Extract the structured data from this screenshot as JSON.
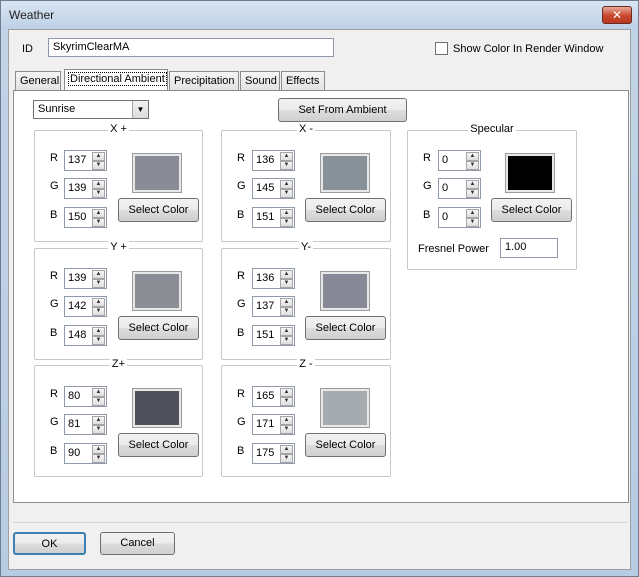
{
  "window": {
    "title": "Weather",
    "close_glyph": "✕"
  },
  "id_field": {
    "label": "ID",
    "value": "SkyrimClearMA"
  },
  "show_color": {
    "label": "Show Color In Render Window",
    "checked": false
  },
  "tabs": [
    {
      "label": "General",
      "active": false
    },
    {
      "label": "Directional Ambient",
      "active": true
    },
    {
      "label": "Precipitation",
      "active": false
    },
    {
      "label": "Sound",
      "active": false
    },
    {
      "label": "Effects",
      "active": false
    }
  ],
  "time_select": {
    "value": "Sunrise"
  },
  "set_from_ambient": "Set From Ambient",
  "select_color_label": "Select Color",
  "channel_labels": {
    "r": "R",
    "g": "G",
    "b": "B"
  },
  "groups": {
    "xpos": {
      "title": "X +",
      "r": "137",
      "g": "139",
      "b": "150",
      "color": "#898b96"
    },
    "xneg": {
      "title": "X -",
      "r": "136",
      "g": "145",
      "b": "151",
      "color": "#889197"
    },
    "ypos": {
      "title": "Y +",
      "r": "139",
      "g": "142",
      "b": "148",
      "color": "#8b8e94"
    },
    "yneg": {
      "title": "Y-",
      "r": "136",
      "g": "137",
      "b": "151",
      "color": "#888997"
    },
    "zpos": {
      "title": "Z+",
      "r": "80",
      "g": "81",
      "b": "90",
      "color": "#50515a"
    },
    "zneg": {
      "title": "Z -",
      "r": "165",
      "g": "171",
      "b": "175",
      "color": "#a5abaf"
    },
    "specular": {
      "title": "Specular",
      "r": "0",
      "g": "0",
      "b": "0",
      "color": "#000000"
    }
  },
  "fresnel": {
    "label": "Fresnel Power",
    "value": "1.00"
  },
  "footer": {
    "ok": "OK",
    "cancel": "Cancel"
  }
}
